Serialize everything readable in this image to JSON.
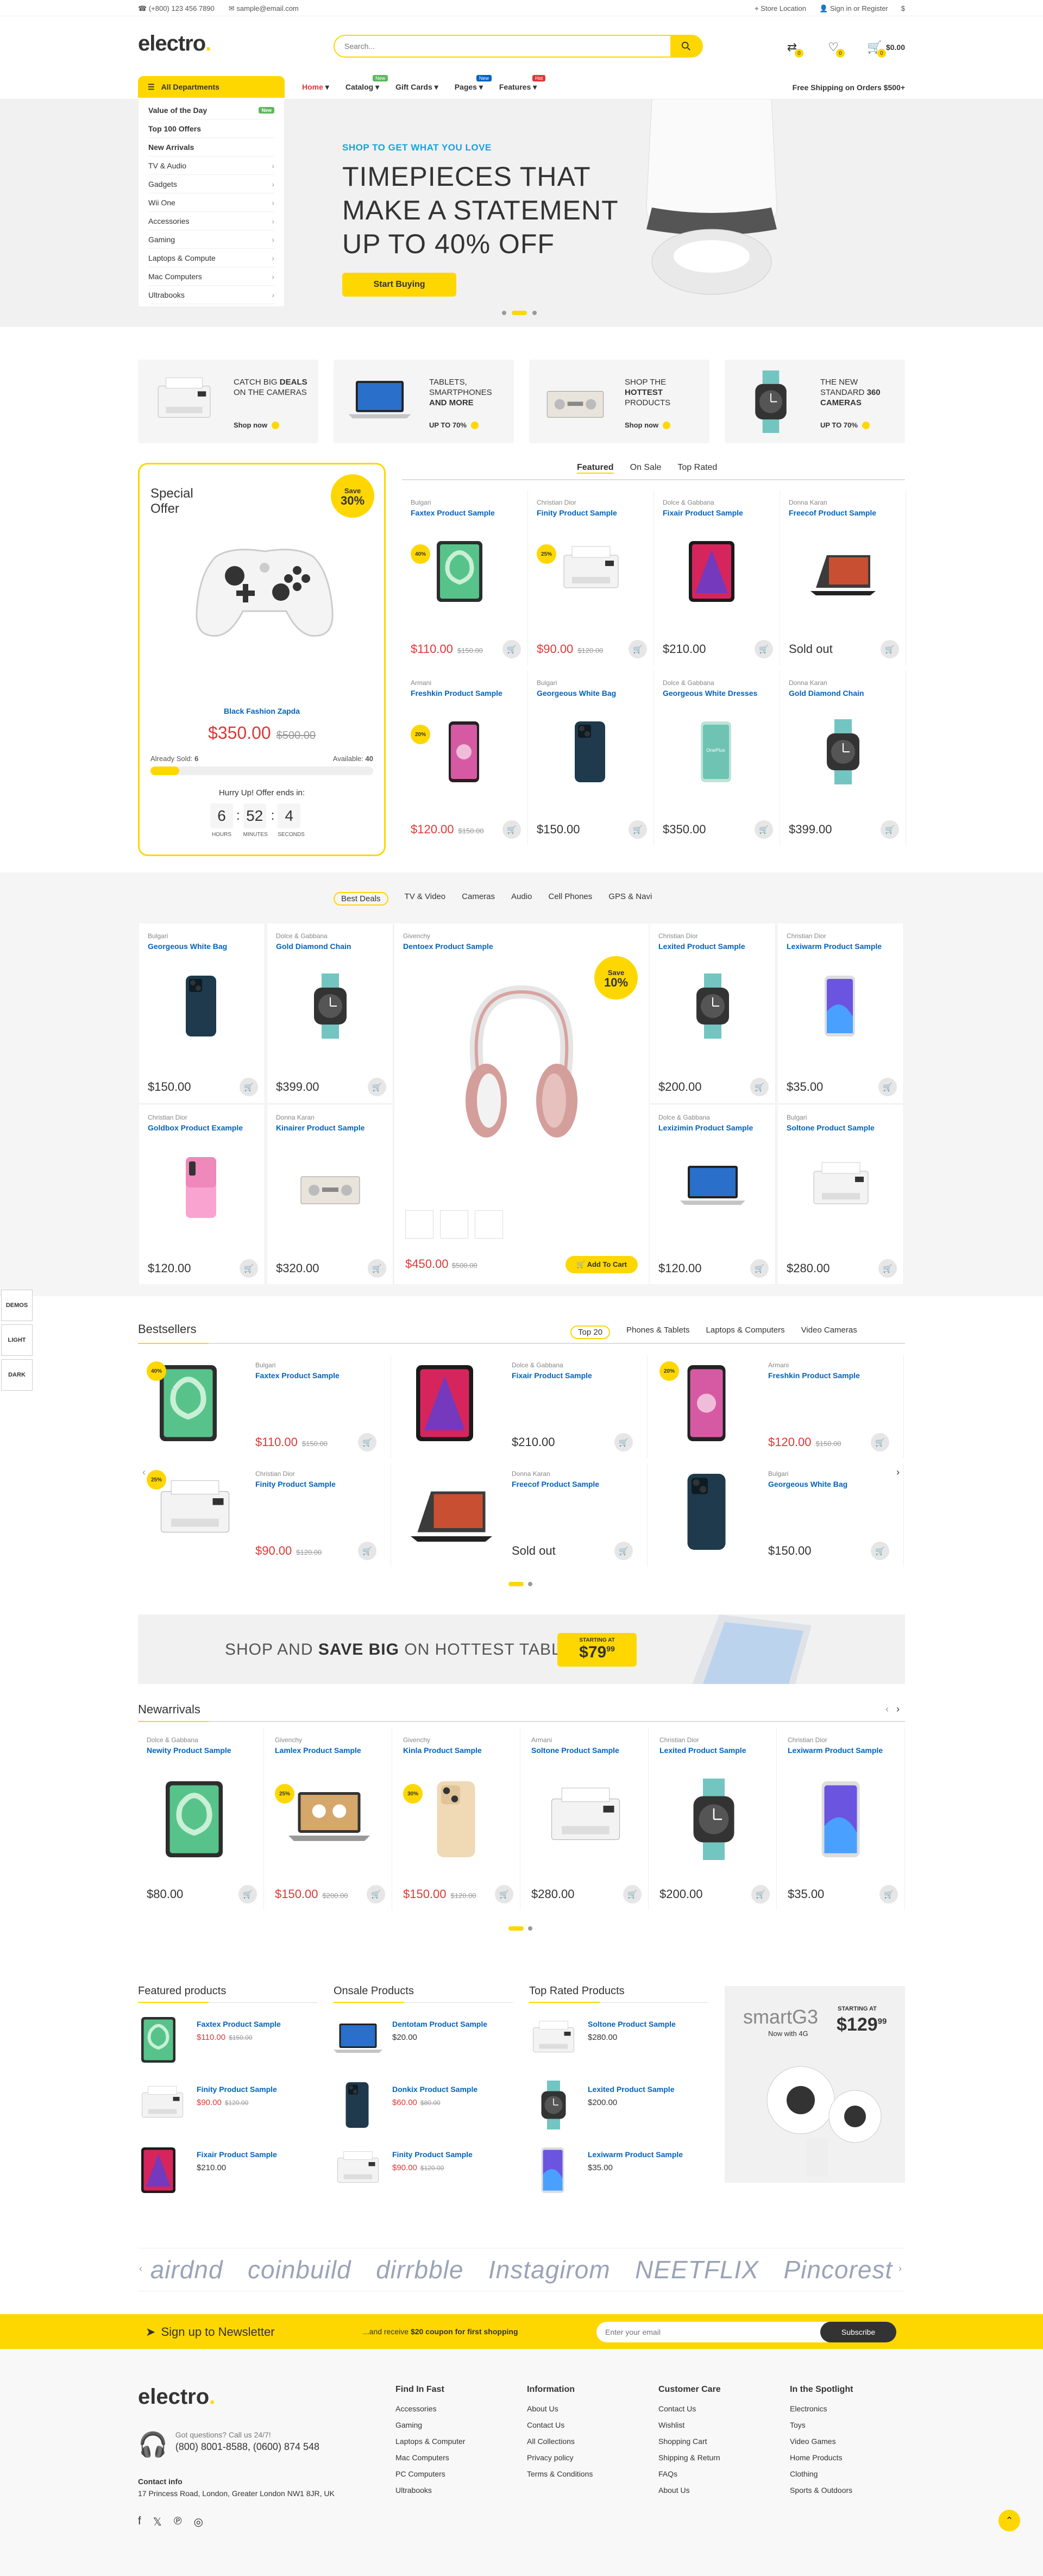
{
  "topbar": {
    "phone": "(+800) 123 456 7890",
    "email": "sample@email.com",
    "store": "Store Location",
    "signin": "Sign in or Register",
    "dollar": "$"
  },
  "logo": {
    "name": "electro",
    "dot": "."
  },
  "search": {
    "placeholder": "Search..."
  },
  "cart": {
    "wish_count": "0",
    "compare_count": "0",
    "cart_count": "0",
    "amount": "$0.00"
  },
  "nav": {
    "all_departments": "All Departments",
    "items": [
      {
        "label": "Home",
        "tag": ""
      },
      {
        "label": "Catalog",
        "tag": "New"
      },
      {
        "label": "Gift Cards",
        "tag": ""
      },
      {
        "label": "Pages",
        "tag": "New"
      },
      {
        "label": "Features",
        "tag": "Hot"
      }
    ],
    "shipping": "Free Shipping on Orders $500+"
  },
  "departments": [
    {
      "label": "Value of the Day",
      "tag": "New",
      "bold": true
    },
    {
      "label": "Top 100 Offers",
      "bold": true
    },
    {
      "label": "New Arrivals",
      "bold": true
    },
    {
      "label": "TV & Audio"
    },
    {
      "label": "Gadgets"
    },
    {
      "label": "Wii One"
    },
    {
      "label": "Accessories"
    },
    {
      "label": "Gaming"
    },
    {
      "label": "Laptops & Compute"
    },
    {
      "label": "Mac Computers"
    },
    {
      "label": "Ultrabooks"
    }
  ],
  "hero": {
    "kicker": "SHOP TO GET WHAT YOU LOVE",
    "line1": "TIMEPIECES THAT",
    "line2": "MAKE A STATEMENT",
    "line3a": "UP TO ",
    "line3b": "40% OFF",
    "button": "Start Buying"
  },
  "promo_banners": [
    {
      "text1": "Catch Big ",
      "text_bold": "Deals",
      "text2": " on the Cameras",
      "cta": "Shop now"
    },
    {
      "text1": "Tablets, Smartphones ",
      "text_bold": "and More",
      "text2": "",
      "cta": "UP TO 70%"
    },
    {
      "text1": "Shop the ",
      "text_bold": "Hottest",
      "text2": " Products",
      "cta": "Shop now"
    },
    {
      "text1": "The New Standard ",
      "text_bold": "360 Cameras",
      "text2": "",
      "cta": "UP TO 70%"
    }
  ],
  "special_offer": {
    "title1": "Special",
    "title2": "Offer",
    "save_label": "Save",
    "save_value": "30%",
    "name": "Black Fashion Zapda",
    "price": "$350.00",
    "old_price": "$500.00",
    "sold_label": "Already Sold:",
    "sold_value": "6",
    "available_label": "Available:",
    "available_value": "40",
    "progress_fraction": 0.13,
    "hurry": "Hurry Up! Offer ends in:",
    "hours": "6",
    "minutes": "52",
    "seconds": "4",
    "hours_label": "HOURS",
    "minutes_label": "MINUTES",
    "seconds_label": "SECONDS"
  },
  "featured_tabs": [
    "Featured",
    "On Sale",
    "Top Rated"
  ],
  "featured_products": [
    {
      "cat": "Bulgari",
      "name": "Faxtex Product Sample",
      "price": "$110.00",
      "old": "$150.00",
      "badge": "40%",
      "img": "ipad-green"
    },
    {
      "cat": "Christian Dior",
      "name": "Finity Product Sample",
      "price": "$90.00",
      "old": "$120.00",
      "badge": "25%",
      "img": "printer"
    },
    {
      "cat": "Dolce & Gabbana",
      "name": "Fixair Product Sample",
      "price": "$210.00",
      "old": "",
      "badge": "",
      "img": "ipad-red"
    },
    {
      "cat": "Donna Karan",
      "name": "Freecof Product Sample",
      "price": "",
      "old": "",
      "badge": "",
      "sold_out": "Sold out",
      "img": "tablet-case"
    },
    {
      "cat": "Armani",
      "name": "Freshkin Product Sample",
      "price": "$120.00",
      "old": "$150.00",
      "badge": "20%",
      "img": "phone-pink"
    },
    {
      "cat": "Bulgari",
      "name": "Georgeous White Bag",
      "price": "$150.00",
      "old": "",
      "badge": "",
      "img": "iphone-blue"
    },
    {
      "cat": "Dolce & Gabbana",
      "name": "Georgeous White Dresses",
      "price": "$350.00",
      "old": "",
      "badge": "",
      "img": "phone-green"
    },
    {
      "cat": "Donna Karan",
      "name": "Gold Diamond Chain",
      "price": "$399.00",
      "old": "",
      "badge": "",
      "img": "watch"
    }
  ],
  "deals_tabs": [
    "Best Deals",
    "TV & Video",
    "Cameras",
    "Audio",
    "Cell Phones",
    "GPS & Navi"
  ],
  "deals_products": [
    {
      "cat": "Bulgari",
      "name": "Georgeous White Bag",
      "price": "$150.00",
      "img": "iphone-blue"
    },
    {
      "cat": "Dolce & Gabbana",
      "name": "Gold Diamond Chain",
      "price": "$399.00",
      "img": "watch"
    },
    {
      "cat": "Christian Dior",
      "name": "Lexited Product Sample",
      "price": "$200.00",
      "img": "watch"
    },
    {
      "cat": "Christian Dior",
      "name": "Lexiwarm Product Sample",
      "price": "$35.00",
      "img": "phone-purple"
    },
    {
      "cat": "Christian Dior",
      "name": "Goldbox Product Example",
      "price": "$120.00",
      "img": "phone-gradient"
    },
    {
      "cat": "Donna Karan",
      "name": "Kinairer Product Sample",
      "price": "$320.00",
      "img": "amp"
    },
    {
      "cat": "Dolce & Gabbana",
      "name": "Lexizimin Product Sample",
      "price": "$120.00",
      "img": "macbook"
    },
    {
      "cat": "Bulgari",
      "name": "Soltone Product Sample",
      "price": "$280.00",
      "img": "printer"
    }
  ],
  "deal_center": {
    "cat": "Givenchy",
    "name": "Dentoex Product Sample",
    "save_label": "Save",
    "save_value": "10%",
    "price": "$450.00",
    "old": "$500.00",
    "button": "Add To Cart"
  },
  "bestsellers": {
    "title": "Bestsellers",
    "tabs": [
      "Top 20",
      "Phones & Tablets",
      "Laptops & Computers",
      "Video Cameras"
    ],
    "products": [
      {
        "cat": "Bulgari",
        "name": "Faxtex Product Sample",
        "price": "$110.00",
        "old": "$150.00",
        "badge": "40%",
        "img": "ipad-green"
      },
      {
        "cat": "Dolce & Gabbana",
        "name": "Fixair Product Sample",
        "price": "$210.00",
        "old": "",
        "badge": "",
        "img": "ipad-red"
      },
      {
        "cat": "Armani",
        "name": "Freshkin Product Sample",
        "price": "$120.00",
        "old": "$150.00",
        "badge": "20%",
        "img": "phone-pink"
      },
      {
        "cat": "Christian Dior",
        "name": "Finity Product Sample",
        "price": "$90.00",
        "old": "$120.00",
        "badge": "25%",
        "img": "printer"
      },
      {
        "cat": "Donna Karan",
        "name": "Freecof Product Sample",
        "price": "",
        "old": "",
        "badge": "",
        "sold_out": "Sold out",
        "img": "tablet-case"
      },
      {
        "cat": "Bulgari",
        "name": "Georgeous White Bag",
        "price": "$150.00",
        "old": "",
        "badge": "",
        "img": "iphone-blue"
      }
    ]
  },
  "tablet_banner": {
    "text1": "SHOP AND ",
    "bold": "SAVE BIG",
    "text2": " ON HOTTEST TABLETS",
    "starting": "STARTING AT",
    "price": "$79",
    "cents": "99"
  },
  "new_arrivals": {
    "title": "Newarrivals",
    "products": [
      {
        "cat": "Dolce & Gabbana",
        "name": "Newity Product Sample",
        "price": "$80.00",
        "old": "",
        "badge": "",
        "img": "ipad-green"
      },
      {
        "cat": "Givenchy",
        "name": "Lamlex Product Sample",
        "price": "$150.00",
        "old": "$200.00",
        "badge": "25%",
        "img": "laptop"
      },
      {
        "cat": "Givenchy",
        "name": "Kinla Product Sample",
        "price": "$150.00",
        "old": "$120.00",
        "badge": "30%",
        "img": "iphone-gold"
      },
      {
        "cat": "Armani",
        "name": "Soltone Product Sample",
        "price": "$280.00",
        "old": "",
        "badge": "",
        "img": "printer"
      },
      {
        "cat": "Christian Dior",
        "name": "Lexited Product Sample",
        "price": "$200.00",
        "old": "",
        "badge": "",
        "img": "watch"
      },
      {
        "cat": "Christian Dior",
        "name": "Lexiwarm Product Sample",
        "price": "$35.00",
        "old": "",
        "badge": "",
        "img": "phone-purple"
      }
    ]
  },
  "lists": [
    {
      "title": "Featured products",
      "items": [
        {
          "name": "Faxtex Product Sample",
          "price": "$110.00",
          "old": "$150.00",
          "img": "ipad-green"
        },
        {
          "name": "Finity Product Sample",
          "price": "$90.00",
          "old": "$120.00",
          "img": "printer"
        },
        {
          "name": "Fixair Product Sample",
          "price": "$210.00",
          "old": "",
          "img": "ipad-red"
        }
      ]
    },
    {
      "title": "Onsale Products",
      "items": [
        {
          "name": "Dentotam Product Sample",
          "price": "$20.00",
          "old": "",
          "img": "macbook"
        },
        {
          "name": "Donkix Product Sample",
          "price": "$60.00",
          "old": "$80.00",
          "img": "iphone-blue"
        },
        {
          "name": "Finity Product Sample",
          "price": "$90.00",
          "old": "$120.00",
          "img": "printer"
        }
      ]
    },
    {
      "title": "Top Rated Products",
      "items": [
        {
          "name": "Soltone Product Sample",
          "price": "$280.00",
          "old": "",
          "img": "printer"
        },
        {
          "name": "Lexited Product Sample",
          "price": "$200.00",
          "old": "",
          "img": "watch"
        },
        {
          "name": "Lexiwarm Product Sample",
          "price": "$35.00",
          "old": "",
          "img": "phone-purple"
        }
      ]
    }
  ],
  "gear_banner": {
    "title": "smartG3",
    "sub": "Now with 4G",
    "starting": "STARTING AT",
    "price": "$129",
    "cents": "99"
  },
  "brands": [
    "airdnd",
    "coinbuild",
    "dirrbble",
    "Instagirom",
    "NEETFLIX",
    "Pincorest"
  ],
  "newsletter": {
    "title": "Sign up to Newsletter",
    "text1": "...and receive ",
    "bold": "$20 coupon for first shopping",
    "placeholder": "Enter your email",
    "button": "Subscribe"
  },
  "footer": {
    "questions": "Got questions? Call us 24/7!",
    "phone": "(800) 8001-8588, (0600) 874 548",
    "contact_title": "Contact info",
    "address": "17 Princess Road, London, Greater London NW1 8JR, UK",
    "cols": [
      {
        "title": "Find In Fast",
        "items": [
          "Accessories",
          "Gaming",
          "Laptops & Computer",
          "Mac Computers",
          "PC Computers",
          "Ultrabooks"
        ]
      },
      {
        "title": "Information",
        "items": [
          "About Us",
          "Contact Us",
          "All Collections",
          "Privacy policy",
          "Terms & Conditions"
        ]
      },
      {
        "title": "Customer Care",
        "items": [
          "Contact Us",
          "Wishlist",
          "Shopping Cart",
          "Shipping & Return",
          "FAQs",
          "About Us"
        ]
      },
      {
        "title": "In the Spotlight",
        "items": [
          "Electronics",
          "Toys",
          "Video Games",
          "Home Products",
          "Clothing",
          "Sports & Outdoors"
        ]
      }
    ]
  },
  "side_buttons": [
    "DEMOS",
    "LIGHT",
    "DARK"
  ],
  "colors": {
    "accent": "#fed700",
    "link": "#0062bd",
    "sale": "#df3737",
    "cyan": "#0fa5e0"
  }
}
